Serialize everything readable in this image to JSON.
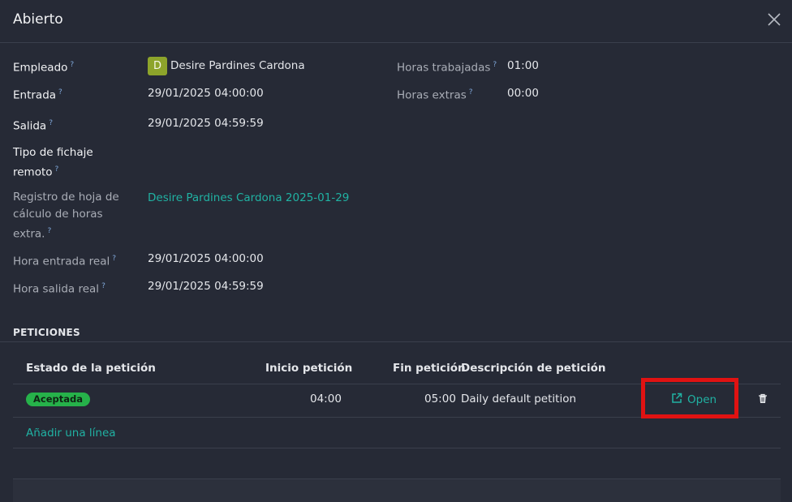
{
  "dialog": {
    "title": "Abierto",
    "help_mark": "?"
  },
  "fields": {
    "empleado": {
      "label": "Empleado",
      "avatar_letter": "D",
      "value": "Desire Pardines Cardona"
    },
    "entrada": {
      "label": "Entrada",
      "value": "29/01/2025 04:00:00"
    },
    "salida": {
      "label": "Salida",
      "value": "29/01/2025 04:59:59"
    },
    "tipo_fichaje": {
      "label_line1": "Tipo de fichaje",
      "label_line2": "remoto",
      "value": ""
    },
    "registro_hoja": {
      "label_line1": "Registro de hoja de",
      "label_line2": "cálculo de horas",
      "label_line3": "extra.",
      "value": "Desire Pardines Cardona 2025-01-29"
    },
    "hora_entrada_real": {
      "label": "Hora entrada real",
      "value": "29/01/2025 04:00:00"
    },
    "hora_salida_real": {
      "label": "Hora salida real",
      "value": "29/01/2025 04:59:59"
    },
    "horas_trabajadas": {
      "label": "Horas trabajadas",
      "value": "01:00"
    },
    "horas_extras": {
      "label": "Horas extras",
      "value": "00:00"
    }
  },
  "peticiones": {
    "section_title": "PETICIONES",
    "columns": [
      "Estado de la petición",
      "Inicio petición",
      "Fin petición",
      "Descripción de petición"
    ],
    "rows": [
      {
        "estado": "Aceptada",
        "inicio": "04:00",
        "fin": "05:00",
        "descripcion": "Daily default petition",
        "open_label": "Open"
      }
    ],
    "add_line_label": "Añadir una línea"
  },
  "colors": {
    "accent": "#20b2a3",
    "badge_green": "#26b24a",
    "highlight_red": "#e01212",
    "avatar": "#8da42b"
  }
}
